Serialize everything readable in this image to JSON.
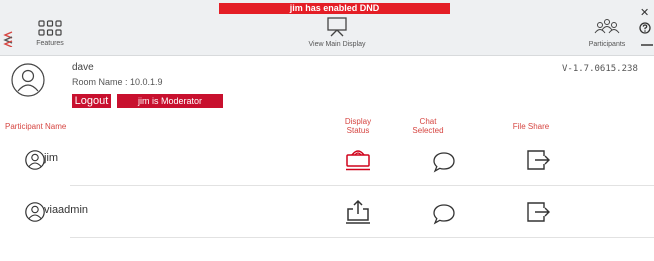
{
  "banner": {
    "text": "jim has enabled DND"
  },
  "toolbar": {
    "features_label": "Features",
    "main_display_label": "View Main Display",
    "participants_label": "Participants"
  },
  "user": {
    "name": "dave",
    "room_label": "Room Name : 10.0.1.9",
    "version": "V-1.7.0615.238",
    "logout_label": "Logout",
    "moderator_label": "jim is Moderator"
  },
  "table": {
    "headers": {
      "name": "Participant Name",
      "display_line1": "Display",
      "display_line2": "Status",
      "chat_line1": "Chat",
      "chat_line2": "Selected",
      "file": "File Share"
    },
    "rows": [
      {
        "name": "jim",
        "display_status": "dnd-screen"
      },
      {
        "name": "viaadmin",
        "display_status": "share-upload"
      }
    ]
  },
  "colors": {
    "accent": "#c8102e",
    "banner": "#e41e26",
    "header_text": "#d64541",
    "toolbar_bg": "#eef0f2"
  }
}
